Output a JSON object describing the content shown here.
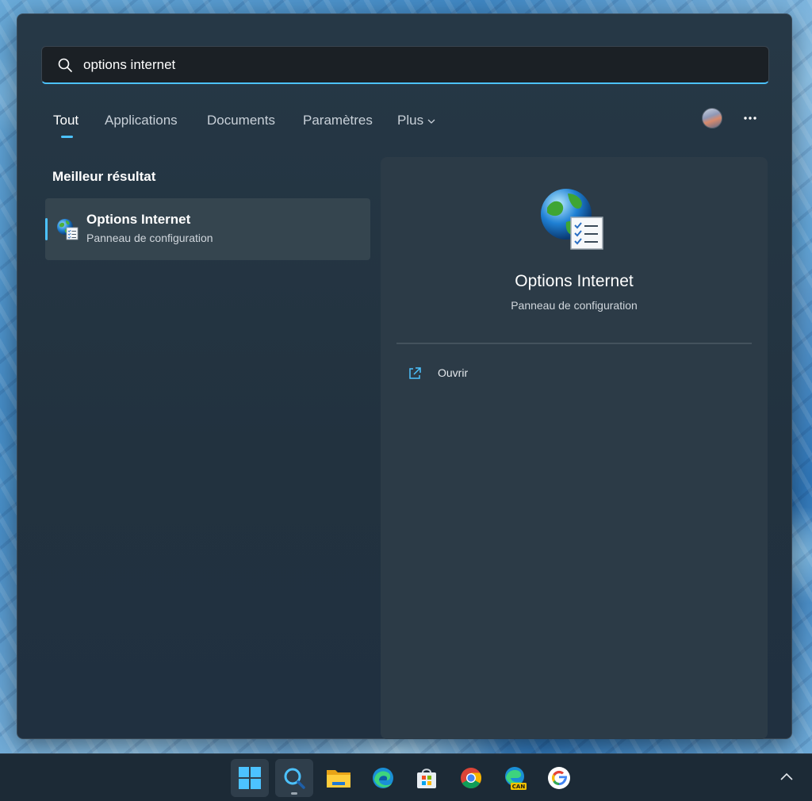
{
  "search": {
    "query": "options internet"
  },
  "tabs": [
    {
      "label": "Tout",
      "active": true
    },
    {
      "label": "Applications"
    },
    {
      "label": "Documents"
    },
    {
      "label": "Paramètres"
    },
    {
      "label": "Plus"
    }
  ],
  "results": {
    "section_title": "Meilleur résultat",
    "best": {
      "title": "Options Internet",
      "subtitle": "Panneau de configuration",
      "icon": "internet-options-icon"
    }
  },
  "detail": {
    "title": "Options Internet",
    "subtitle": "Panneau de configuration",
    "icon": "internet-options-icon",
    "actions": [
      {
        "label": "Ouvrir",
        "icon": "open-external-icon"
      }
    ]
  },
  "taskbar": {
    "items": [
      {
        "name": "start-icon"
      },
      {
        "name": "search-taskbar-icon",
        "active": true
      },
      {
        "name": "file-explorer-icon"
      },
      {
        "name": "edge-icon"
      },
      {
        "name": "microsoft-store-icon"
      },
      {
        "name": "chrome-icon"
      },
      {
        "name": "edge-canary-icon",
        "badge": "CAN"
      },
      {
        "name": "google-icon"
      }
    ]
  },
  "colors": {
    "accent": "#4cc2ff",
    "panel": "#263846",
    "detail_panel": "#2c3b47",
    "taskbar": "#1c2a36"
  }
}
